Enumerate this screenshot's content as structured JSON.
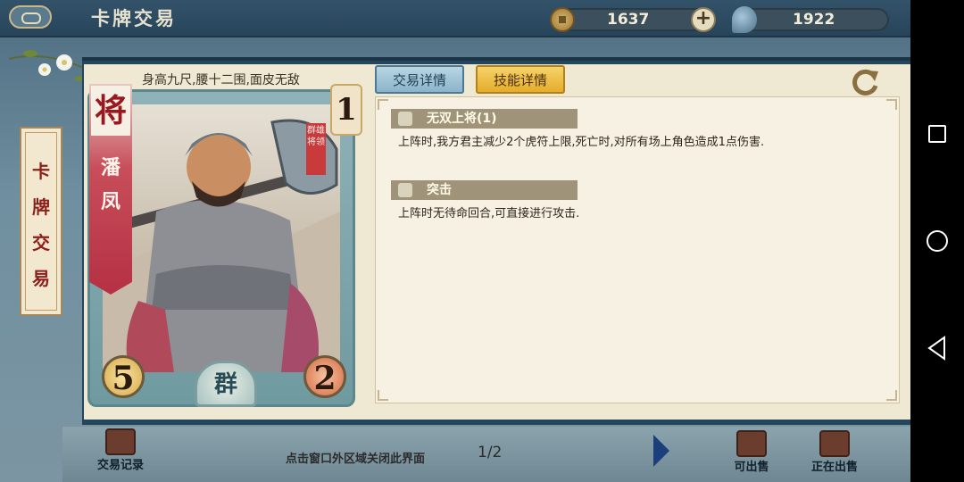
{
  "header": {
    "title": "卡牌交易"
  },
  "currency": {
    "coins": "1637",
    "jade": "1922"
  },
  "side_tab": {
    "chars": [
      "卡",
      "牌",
      "交",
      "易"
    ]
  },
  "card": {
    "description": "身高九尺,腰十二围,面皮无敌",
    "rank_char": "将",
    "name_chars": [
      "潘",
      "凤"
    ],
    "star": "1",
    "seal_text": "群雄将领",
    "attack": "5",
    "health": "2",
    "faction": "群"
  },
  "tabs": {
    "trade": "交易详情",
    "skill": "技能详情"
  },
  "skills": [
    {
      "name": "无双上将(1)",
      "desc": "上阵时,我方君主减少2个虎符上限,死亡时,对所有场上角色造成1点伤害."
    },
    {
      "name": "突击",
      "desc": "上阵时无待命回合,可直接进行攻击."
    }
  ],
  "bottom": {
    "record": "交易记录",
    "close_hint": "点击窗口外区域关闭此界面",
    "page": "1/2",
    "sellable": "可出售",
    "selling": "正在出售"
  },
  "colors": {
    "accent": "#e4ad2a",
    "panel": "#24465c",
    "parchment": "#efe8d2"
  }
}
